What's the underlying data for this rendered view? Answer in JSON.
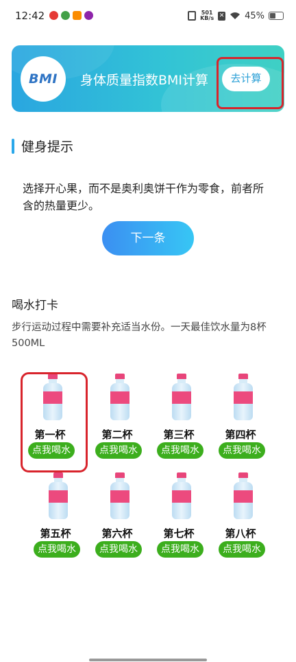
{
  "status_bar": {
    "time": "12:42",
    "net_speed_value": "501",
    "net_speed_unit": "KB/s",
    "battery": "45%",
    "app_icon_colors": [
      "#e53935",
      "#43a047",
      "#fb8c00",
      "#8e24aa"
    ]
  },
  "bmi": {
    "logo_text": "BMI",
    "title": "身体质量指数BMI计算",
    "button_label": "去计算",
    "gradient_start": "#2aa6e0",
    "gradient_end": "#3fd0c4"
  },
  "tips": {
    "title": "健身提示",
    "text": "选择开心果，而不是奥利奥饼干作为零食，前者所含的热量更少。",
    "next_label": "下一条"
  },
  "water": {
    "title": "喝水打卡",
    "description": "步行运动过程中需要补充适当水份。一天最佳饮水量为8杯500ML",
    "button_color": "#3cae1d",
    "cups": [
      {
        "name": "第一杯",
        "button": "点我喝水"
      },
      {
        "name": "第二杯",
        "button": "点我喝水"
      },
      {
        "name": "第三杯",
        "button": "点我喝水"
      },
      {
        "name": "第四杯",
        "button": "点我喝水"
      },
      {
        "name": "第五杯",
        "button": "点我喝水"
      },
      {
        "name": "第六杯",
        "button": "点我喝水"
      },
      {
        "name": "第七杯",
        "button": "点我喝水"
      },
      {
        "name": "第八杯",
        "button": "点我喝水"
      }
    ]
  },
  "highlight_color": "#d8242c"
}
